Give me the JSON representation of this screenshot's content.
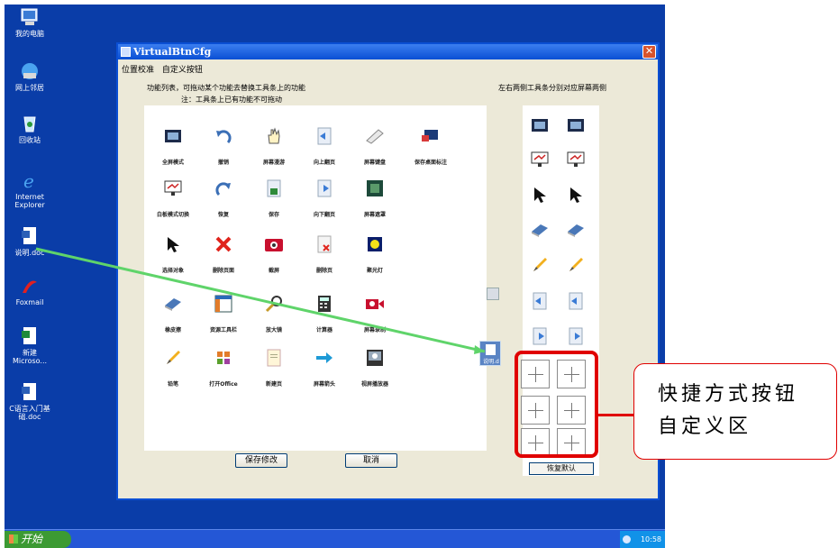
{
  "desktop": {
    "icons": [
      {
        "label": "我的电脑",
        "icon": "my-computer-icon"
      },
      {
        "label": "网上邻居",
        "icon": "network-icon"
      },
      {
        "label": "回收站",
        "icon": "recycle-bin-icon"
      },
      {
        "label": "Internet\nExplorer",
        "icon": "ie-icon"
      },
      {
        "label": "说明.doc",
        "icon": "word-doc-icon"
      },
      {
        "label": "Foxmail",
        "icon": "foxmail-icon"
      },
      {
        "label": "新建\nMicroso...",
        "icon": "excel-icon"
      },
      {
        "label": "C语言入门基\n础.doc",
        "icon": "word-doc-icon"
      }
    ],
    "floating_doc_label": "说明.d"
  },
  "taskbar": {
    "start_label": "开始",
    "clock": "10:58"
  },
  "window": {
    "title": "VirtualBtnCfg",
    "close_label": "✕",
    "menu": [
      "位置校准",
      "自定义按钮"
    ],
    "func_header": "功能列表，可拖动某个功能去替换工具条上的功能",
    "func_note": "注：工具条上已有功能不可拖动",
    "toolbar_header": "左右两侧工具条分别对应屏幕两侧",
    "functions": [
      {
        "label": "全屏模式",
        "icon": "fullscreen-icon"
      },
      {
        "label": "撤销",
        "icon": "undo-icon"
      },
      {
        "label": "屏幕漫游",
        "icon": "hand-icon"
      },
      {
        "label": "向上翻页",
        "icon": "page-up-icon"
      },
      {
        "label": "屏幕键盘",
        "icon": "keyboard-icon"
      },
      {
        "label": "保存桌面标注",
        "icon": "save-desktop-icon"
      },
      {
        "label": "白板模式切换",
        "icon": "whiteboard-icon"
      },
      {
        "label": "恢复",
        "icon": "redo-icon"
      },
      {
        "label": "保存",
        "icon": "save-icon"
      },
      {
        "label": "向下翻页",
        "icon": "page-down-icon"
      },
      {
        "label": "屏幕遮罩",
        "icon": "screen-mask-icon"
      },
      {
        "label": "选择对象",
        "icon": "select-arrow-icon"
      },
      {
        "label": "删除页面",
        "icon": "delete-x-icon"
      },
      {
        "label": "截屏",
        "icon": "camera-icon"
      },
      {
        "label": "删除页",
        "icon": "delete-page-icon"
      },
      {
        "label": "聚光灯",
        "icon": "spotlight-icon"
      },
      {
        "label": "橡皮擦",
        "icon": "eraser-icon"
      },
      {
        "label": "资源工具栏",
        "icon": "resource-toolbar-icon"
      },
      {
        "label": "放大镜",
        "icon": "magnifier-icon"
      },
      {
        "label": "计算器",
        "icon": "calculator-icon"
      },
      {
        "label": "屏幕录制",
        "icon": "recorder-icon"
      },
      {
        "label": "铅笔",
        "icon": "pencil-icon"
      },
      {
        "label": "打开Office",
        "icon": "office-icon"
      },
      {
        "label": "新建页",
        "icon": "new-page-icon"
      },
      {
        "label": "屏幕箭头",
        "icon": "arrow-right-icon"
      },
      {
        "label": "视屏播放器",
        "icon": "video-player-icon"
      }
    ],
    "toolbar_rows": [
      "fullscreen-icon",
      "whiteboard-icon",
      "select-arrow-icon",
      "eraser-icon",
      "pencil-icon",
      "page-up-icon",
      "page-down-icon"
    ],
    "restore_label": "恢复默认",
    "save_label": "保存修改",
    "cancel_label": "取消"
  },
  "annotation": {
    "line1": "快捷方式按钮",
    "line2": "自定义区",
    "color": "#e00000"
  },
  "colors": {
    "desktop": "#0a3da8",
    "window_border": "#0a4fd4",
    "drag_line": "#5fd46a"
  }
}
